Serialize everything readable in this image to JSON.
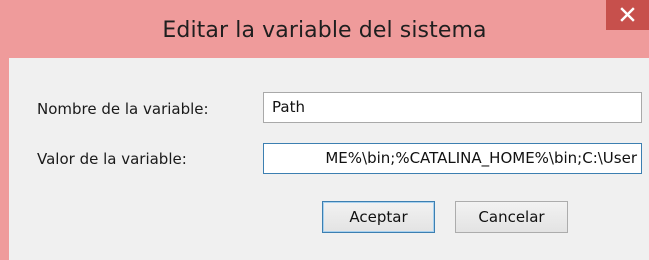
{
  "window": {
    "title": "Editar la variable del sistema",
    "close_glyph": "✕",
    "accent_color": "#ef9b9b",
    "close_color": "#c7504c"
  },
  "form": {
    "name_label": "Nombre de la variable:",
    "name_value": "Path",
    "value_label": "Valor de la variable:",
    "value_value": "ME%\\bin;%CATALINA_HOME%\\bin;C:\\User"
  },
  "buttons": {
    "ok_label": "Aceptar",
    "cancel_label": "Cancelar"
  }
}
